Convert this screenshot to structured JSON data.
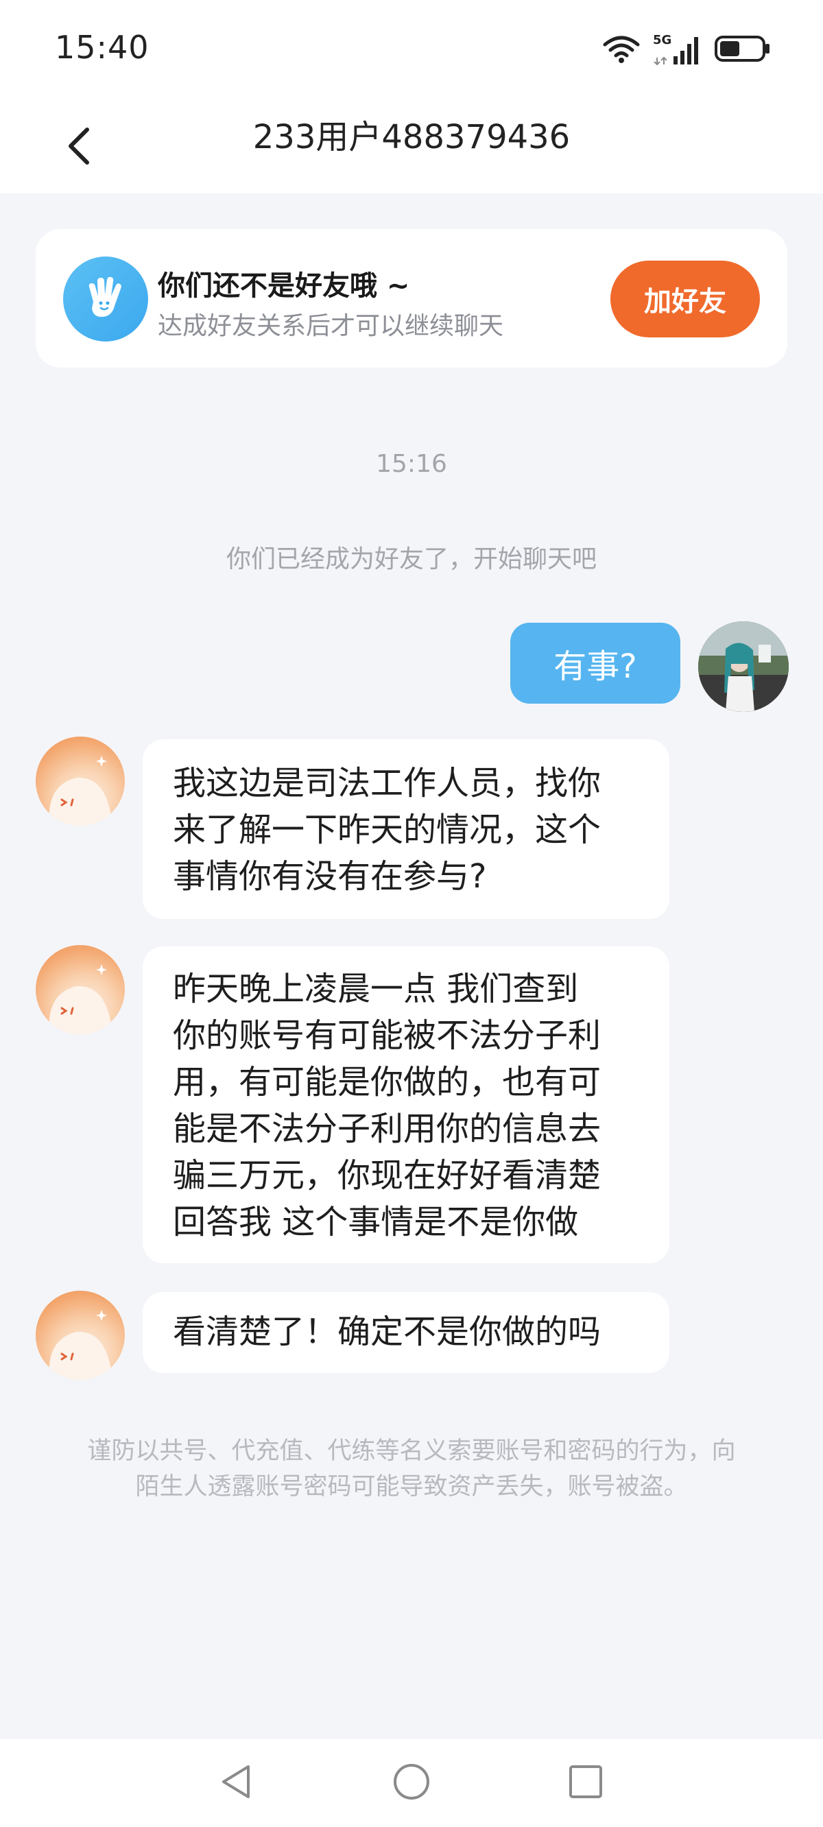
{
  "status_bar": {
    "time": "15:40",
    "network": "5G",
    "icons": [
      "wifi-icon",
      "signal-icon",
      "battery-icon"
    ]
  },
  "header": {
    "title": "233用户488379436",
    "back_icon": "back-arrow-icon"
  },
  "friend_banner": {
    "title": "你们还不是好友哦 ~",
    "subtitle": "达成好友关系后才可以继续聊天",
    "button_label": "加好友",
    "button_color": "#f06a2c",
    "icon": "wave-hand-icon"
  },
  "chat": {
    "timestamp": "15:16",
    "system_message": "你们已经成为好友了，开始聊天吧",
    "messages": [
      {
        "direction": "outgoing",
        "text": "有事?"
      },
      {
        "direction": "incoming",
        "text": "我这边是司法工作人员，找你\n来了解一下昨天的情况，这个\n事情你有没有在参与?"
      },
      {
        "direction": "incoming",
        "text": "昨天晚上凌晨一点 我们查到\n你的账号有可能被不法分子利\n用，有可能是你做的，也有可\n能是不法分子利用你的信息去\n骗三万元，你现在好好看清楚\n回答我 这个事情是不是你做"
      },
      {
        "direction": "incoming",
        "text": "看清楚了！确定不是你做的吗"
      }
    ],
    "warning": "谨防以共号、代充值、代练等名义索要账号和密码的行为，向陌生人透露账号密码可能导致资产丢失，账号被盗。"
  },
  "nav_bar": {
    "icons": [
      "nav-back-icon",
      "nav-home-icon",
      "nav-recents-icon"
    ]
  },
  "colors": {
    "outgoing_bubble": "#56b5f0",
    "page_background": "#f4f5f9",
    "accent": "#f06a2c"
  }
}
